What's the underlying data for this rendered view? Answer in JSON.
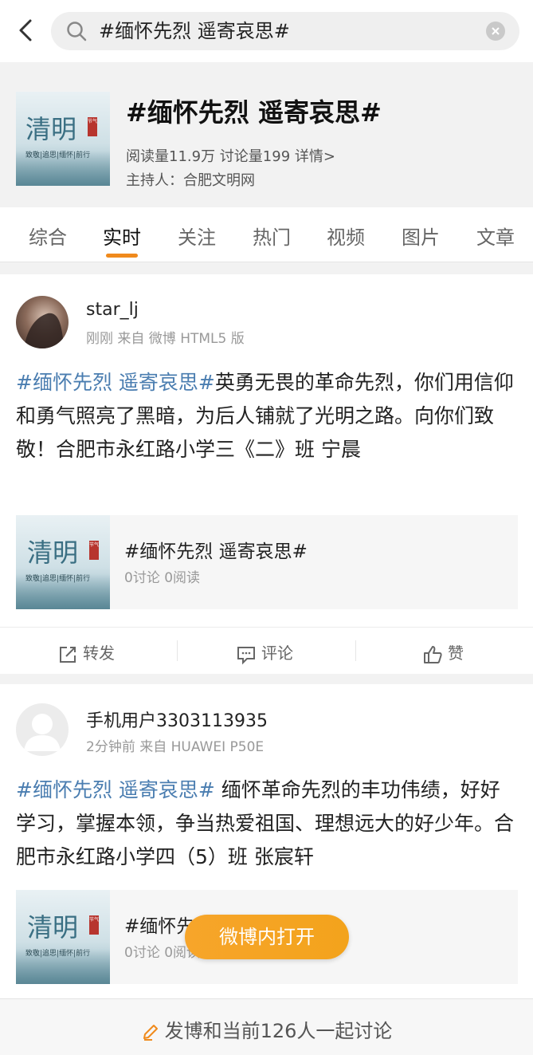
{
  "search": {
    "query": "#缅怀先烈 遥寄哀思#"
  },
  "topic": {
    "cover_title": "清明",
    "cover_stamp": "节气",
    "cover_subtitle": "致敬|追思|缅怀|前行",
    "title": "#缅怀先烈 遥寄哀思#",
    "stats": "阅读量11.9万 讨论量199 详情>",
    "host": "主持人：合肥文明网"
  },
  "tabs": [
    "综合",
    "实时",
    "关注",
    "热门",
    "视频",
    "图片",
    "文章"
  ],
  "active_tab": "实时",
  "posts": [
    {
      "username": "star_lj",
      "meta": "刚刚 来自 微博 HTML5 版",
      "tag": "#缅怀先烈 遥寄哀思#",
      "text": "英勇无畏的革命先烈，你们用信仰和勇气照亮了黑暗，为后人铺就了光明之路。向你们致敬！合肥市永红路小学三《二》班 宁晨",
      "embed_title": "#缅怀先烈 遥寄哀思#",
      "embed_meta": "0讨论 0阅读"
    },
    {
      "username": "手机用户3303113935",
      "meta": "2分钟前 来自 HUAWEI P50E",
      "tag": "#缅怀先烈 遥寄哀思#",
      "text": " 缅怀革命先烈的丰功伟绩，好好学习，掌握本领，争当热爱祖国、理想远大的好少年。合肥市永红路小学四（5）班 张宸轩",
      "embed_title": "#缅怀先烈 遥寄哀思#",
      "embed_meta": "0讨论 0阅读"
    }
  ],
  "actions": {
    "repost": "转发",
    "comment": "评论",
    "like": "赞"
  },
  "open_in_app": "微博内打开",
  "bottom_prompt": "发博和当前126人一起讨论",
  "colors": {
    "accent": "#f08a1c",
    "link": "#4a7db0",
    "open_button": "#f5a623"
  }
}
